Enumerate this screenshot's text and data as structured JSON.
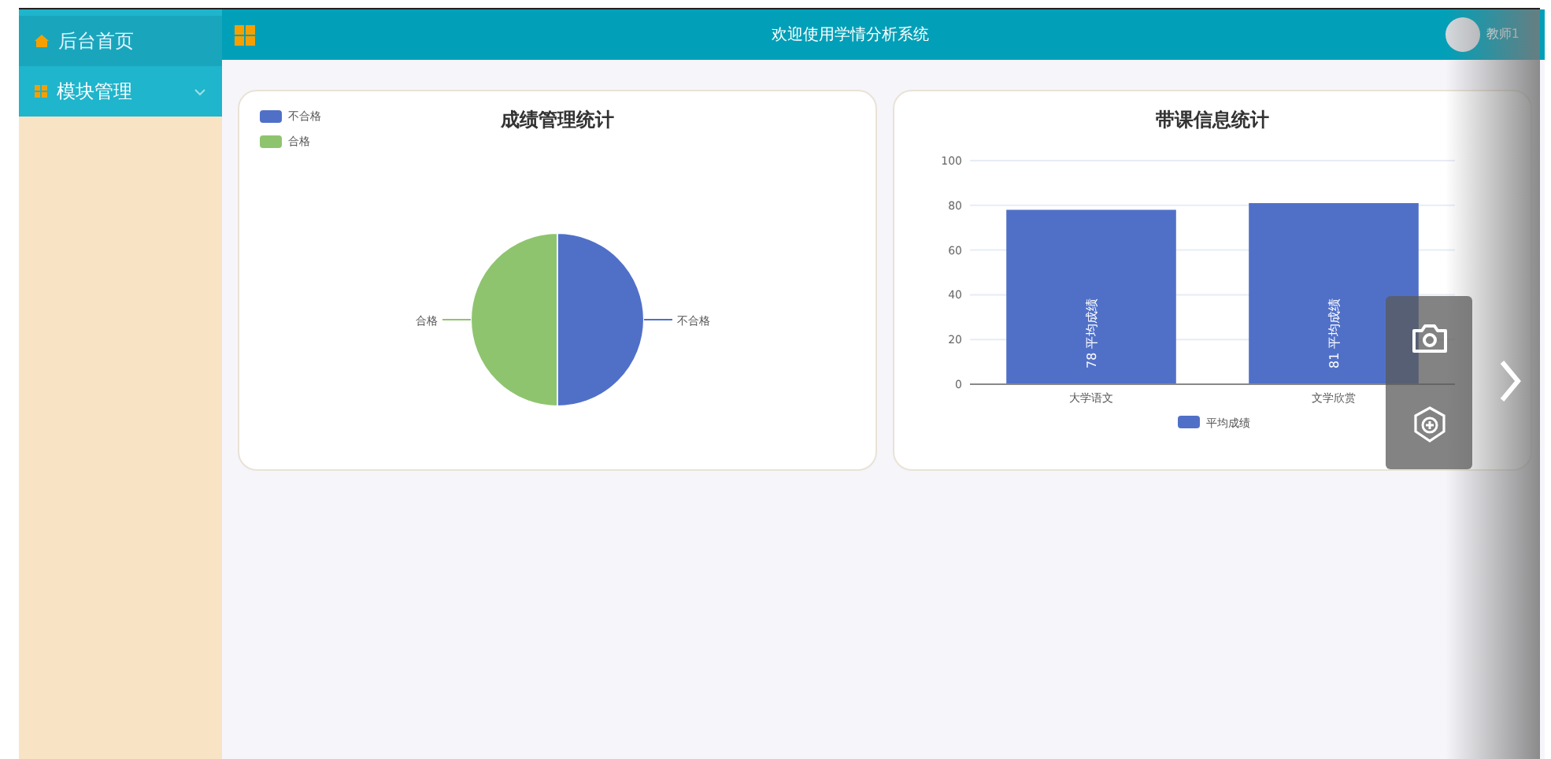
{
  "sidebar": {
    "items": [
      {
        "label": "后台首页",
        "kind": "link",
        "selected": true
      },
      {
        "label": "模块管理",
        "kind": "submenu",
        "selected": false,
        "expanded": false
      }
    ]
  },
  "header": {
    "title": "欢迎使用学情分析系统",
    "user": "教师1"
  },
  "pie_card": {
    "title": "成绩管理统计",
    "legend": [
      {
        "label": "不合格",
        "color": "#5070c8"
      },
      {
        "label": "合格",
        "color": "#8fc46f"
      }
    ],
    "slice_labels": [
      "合格",
      "不合格"
    ]
  },
  "bar_card": {
    "title": "带课信息统计",
    "chart_data": {
      "type": "bar",
      "categories": [
        "大学语文",
        "文学欣赏"
      ],
      "series": [
        {
          "name": "平均成绩",
          "color": "#5070c8",
          "values": [
            78,
            81
          ]
        }
      ],
      "ylim": [
        0,
        100
      ],
      "yticks": [
        0,
        20,
        40,
        60,
        80,
        100
      ],
      "grid": true,
      "value_labels": [
        "78  平均成绩",
        "81  平均成绩"
      ]
    }
  }
}
